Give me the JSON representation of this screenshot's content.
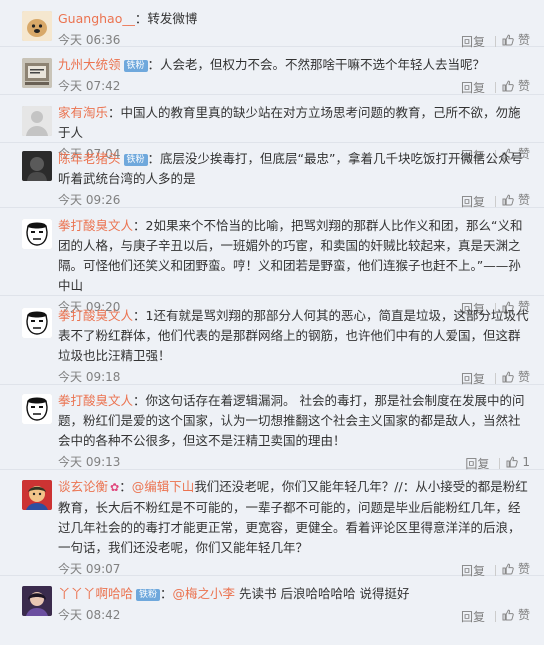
{
  "labels": {
    "reply": "回复",
    "like": "赞"
  },
  "comments": [
    {
      "user": "Guanghao__",
      "badge": "",
      "emoji": "",
      "sep": "：",
      "mention": "",
      "text": "转发微博",
      "time": "今天 06:36",
      "likes": ""
    },
    {
      "user": "九州大统领",
      "badge": "铁粉",
      "emoji": "",
      "sep": "：",
      "mention": "",
      "text": "人会老，但权力不会。不然那啥干嘛不选个年轻人去当呢？",
      "time": "今天 07:42",
      "likes": ""
    },
    {
      "user": "家有淘乐",
      "badge": "",
      "emoji": "",
      "sep": "：",
      "mention": "",
      "text": "中国人的教育里真的缺少站在对方立场思考问题的教育，己所不欲，勿施于人",
      "time": "今天 07:04",
      "likes": ""
    },
    {
      "user": "陈年老猪头",
      "badge": "铁粉",
      "emoji": "",
      "sep": "：",
      "mention": "",
      "text": "底层没少挨毒打，但底层“最忠”，拿着几千块吃饭打开微信公众号听着武统台湾的人多的是",
      "time": "今天 09:26",
      "likes": ""
    },
    {
      "user": "拳打酸臭文人",
      "badge": "",
      "emoji": "",
      "sep": "：",
      "mention": "",
      "text": "2如果来个不恰当的比喻，把骂刘翔的那群人比作义和团，那么“义和团的人格，与庚子辛丑以后，一班媚外的巧宦，和卖国的奸贼比较起来，真是天渊之隔。可怪他们还笑义和团野蛮。哼！义和团若是野蛮，他们连猴子也赶不上。”——孙中山",
      "time": "今天 09:20",
      "likes": ""
    },
    {
      "user": "拳打酸臭文人",
      "badge": "",
      "emoji": "",
      "sep": "：",
      "mention": "",
      "text": "1还有就是骂刘翔的那部分人何其的恶心，简直是垃圾，这部分垃圾代表不了粉红群体，他们代表的是那群网络上的钢筋，也许他们中有的人爱国，但这群垃圾也比汪精卫强！",
      "time": "今天 09:18",
      "likes": ""
    },
    {
      "user": "拳打酸臭文人",
      "badge": "",
      "emoji": "",
      "sep": "：",
      "mention": "",
      "text": "你这句话存在着逻辑漏洞。 社会的毒打，那是社会制度在发展中的问题，粉红们是爱的这个国家，认为一切想推翻这个社会主义国家的都是敌人，当然社会中的各种不公很多，但这不是汪精卫卖国的理由！",
      "time": "今天 09:13",
      "likes": "1"
    },
    {
      "user": "谈玄论衡",
      "badge": "",
      "emoji": "✿",
      "sep": "：",
      "mention": "@编辑下山",
      "text": "我们还没老呢，你们又能年轻几年？//：从小接受的都是粉红教育，长大后不粉红是不可能的，一辈子都不可能的，问题是毕业后能粉红几年，经过几年社会的的毒打才能更正常，更宽容，更健全。看着评论区里得意洋洋的后浪，一句话，我们还没老呢，你们又能年轻几年？",
      "time": "今天 09:07",
      "likes": ""
    },
    {
      "user": "丫丫丫啊哈哈",
      "badge": "铁粉",
      "emoji": "",
      "sep": "：",
      "mention": "@梅之小李",
      "text": " 先读书 后浪哈哈哈哈 说得挺好",
      "time": "今天 08:42",
      "likes": ""
    }
  ]
}
